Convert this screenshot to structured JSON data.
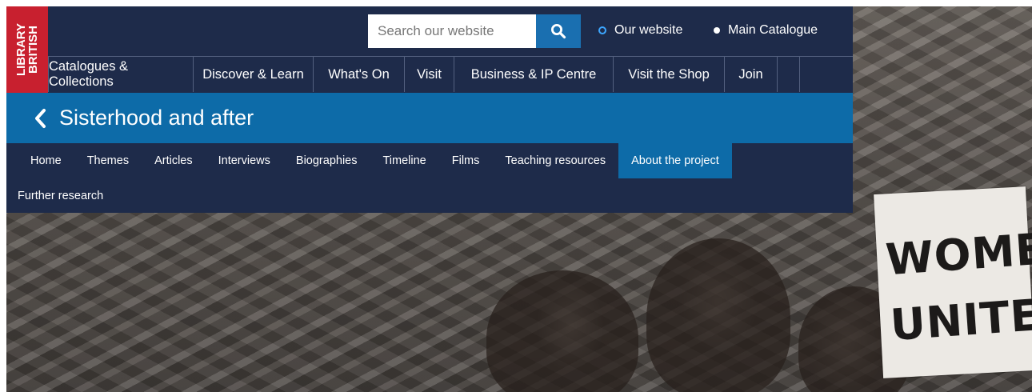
{
  "logo": {
    "line1": "LIBRARY",
    "line2": "BRITISH"
  },
  "search": {
    "placeholder": "Search our website",
    "button_icon": "search-icon"
  },
  "search_scope": [
    {
      "label": "Our website",
      "selected": true
    },
    {
      "label": "Main Catalogue",
      "selected": false
    }
  ],
  "main_nav": [
    {
      "label": "Catalogues & Collections"
    },
    {
      "label": "Discover & Learn"
    },
    {
      "label": "What's On"
    },
    {
      "label": "Visit"
    },
    {
      "label": "Business & IP Centre"
    },
    {
      "label": "Visit the Shop"
    },
    {
      "label": "Join"
    }
  ],
  "section": {
    "back_icon": "chevron-left-icon",
    "title": "Sisterhood and after"
  },
  "sub_nav": [
    {
      "label": "Home"
    },
    {
      "label": "Themes"
    },
    {
      "label": "Articles"
    },
    {
      "label": "Interviews"
    },
    {
      "label": "Biographies"
    },
    {
      "label": "Timeline"
    },
    {
      "label": "Films"
    },
    {
      "label": "Teaching resources"
    },
    {
      "label": "About the project",
      "active": true
    },
    {
      "label": "Further research"
    }
  ],
  "hero": {
    "placard_line1": "WOMEN",
    "placard_line2": "UNITE"
  },
  "colors": {
    "navy": "#1e2b4a",
    "blue": "#0d6ba8",
    "brand_red": "#c8202f",
    "search_button": "#1a6fb0"
  }
}
